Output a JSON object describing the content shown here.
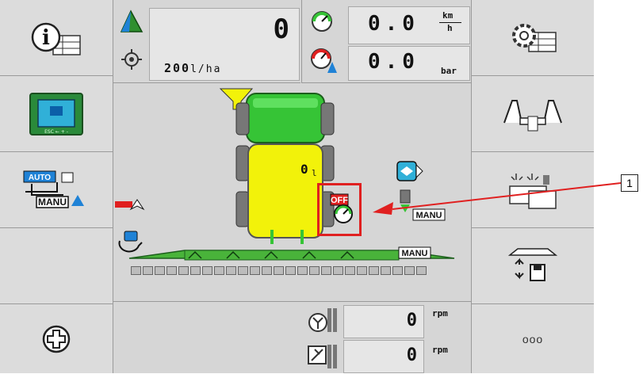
{
  "left_softkeys": [
    {
      "name": "info-button",
      "icon": "info-icon"
    },
    {
      "name": "terminal-button",
      "icon": "terminal-icon"
    },
    {
      "name": "auto-manu-button",
      "icon": "auto-manu-icon",
      "auto": "AUTO",
      "manu": "MANU"
    },
    {
      "name": "empty-softkey"
    },
    {
      "name": "plus-button",
      "icon": "plus-icon"
    }
  ],
  "right_softkeys": [
    {
      "name": "settings-button",
      "icon": "gear-icon"
    },
    {
      "name": "boom-fold-button",
      "icon": "boom-fold-icon"
    },
    {
      "name": "lighting-button",
      "icon": "light-icon"
    },
    {
      "name": "boom-height-button",
      "icon": "boom-height-icon"
    },
    {
      "name": "more-button",
      "label": "ooo"
    }
  ],
  "header": {
    "area_value": "0",
    "rate_value": "200",
    "rate_unit": "l/ha",
    "speed_value": "0.0",
    "speed_unit_top": "km",
    "speed_unit_bottom": "h",
    "pressure_value": "0.0",
    "pressure_unit": "bar"
  },
  "machine": {
    "tank_value": "0",
    "tank_unit": "l",
    "main_valve_state": "OFF",
    "agitator_mode": "MANU",
    "boom_mode": "MANU",
    "boom_sections": 5
  },
  "footer": {
    "fan1_value": "0",
    "fan1_unit": "rpm",
    "fan2_value": "0",
    "fan2_unit": "rpm"
  },
  "annotation": {
    "number": "1"
  },
  "colors": {
    "highlight": "#e02020",
    "tank_yellow": "#f2f20a",
    "tractor_green": "#36c436",
    "boom_green": "#49b33a",
    "icon_blue": "#1f82d6"
  }
}
